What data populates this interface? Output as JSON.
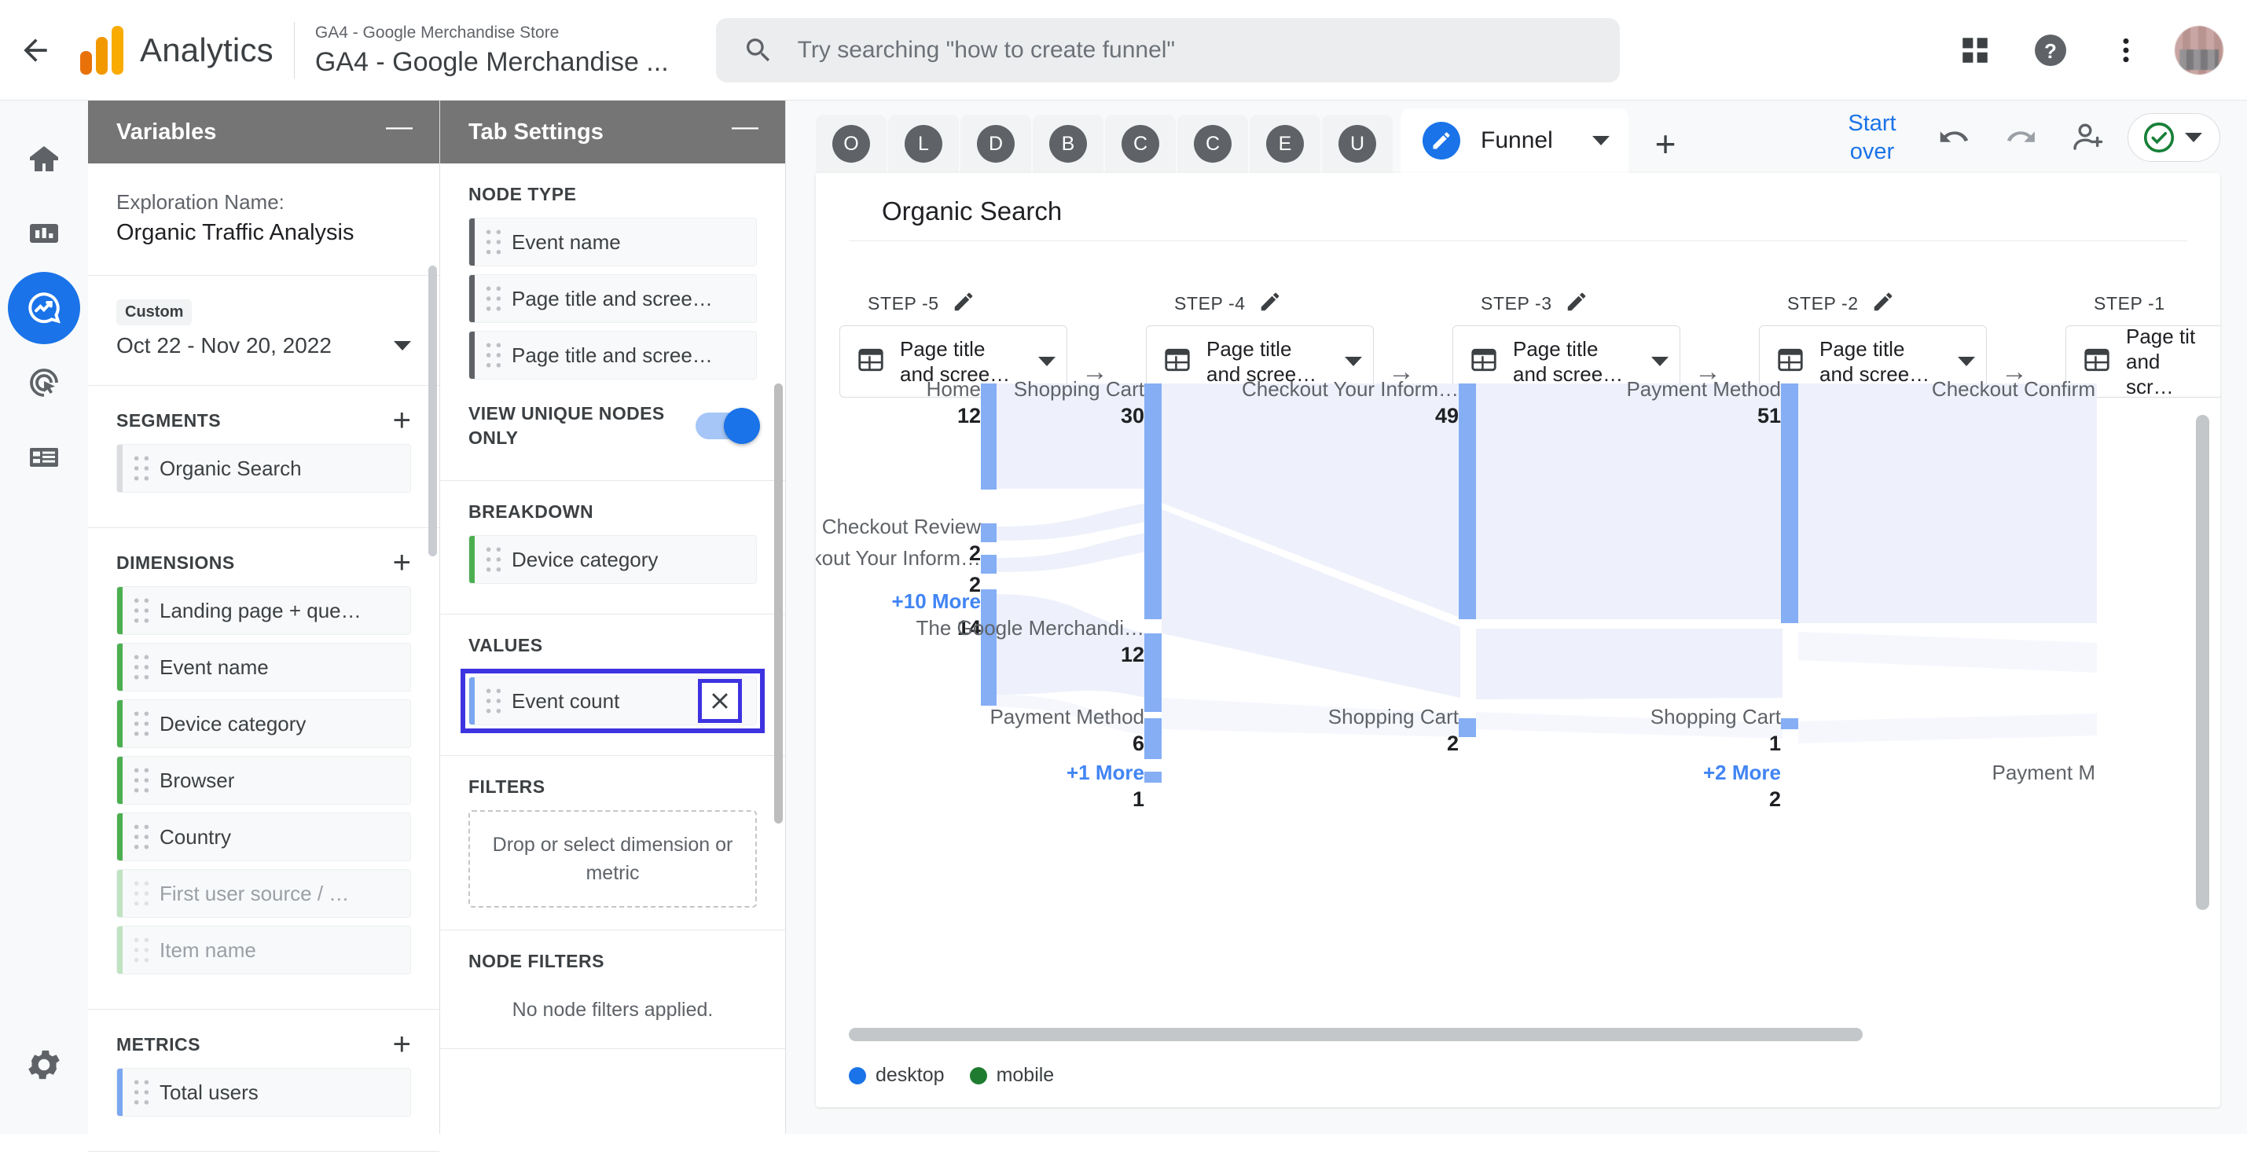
{
  "header": {
    "back_icon": "arrow-left-icon",
    "brand": "Analytics",
    "account_sub": "GA4 - Google Merchandise Store",
    "property_name": "GA4 - Google Merchandise ...",
    "search_placeholder": "Try searching \"how to create funnel\"",
    "search_value": "",
    "apps_icon": "apps-grid-icon",
    "help_icon": "help-circle-icon",
    "more_icon": "more-vertical-icon",
    "avatar_icon": "user-avatar"
  },
  "rail": {
    "items": [
      {
        "name": "home",
        "icon": "home-icon",
        "active": false
      },
      {
        "name": "reports",
        "icon": "bar-chart-icon",
        "active": false
      },
      {
        "name": "explore",
        "icon": "explore-icon",
        "active": true
      },
      {
        "name": "advertising",
        "icon": "advertising-target-icon",
        "active": false
      },
      {
        "name": "library",
        "icon": "library-list-icon",
        "active": false
      }
    ],
    "gear": {
      "name": "admin",
      "icon": "gear-icon"
    }
  },
  "variables": {
    "title": "Variables",
    "minimize": "—",
    "exploration_label": "Exploration Name:",
    "exploration_name": "Organic Traffic Analysis",
    "date_chip": "Custom",
    "date_range": "Oct 22 - Nov 20, 2022",
    "segments": {
      "label": "SEGMENTS",
      "add": "+",
      "items": [
        {
          "label": "Organic Search",
          "tone": "grey"
        }
      ]
    },
    "dimensions": {
      "label": "DIMENSIONS",
      "add": "+",
      "items": [
        {
          "label": "Landing page + que…",
          "tone": "green"
        },
        {
          "label": "Event name",
          "tone": "green"
        },
        {
          "label": "Device category",
          "tone": "green"
        },
        {
          "label": "Browser",
          "tone": "green"
        },
        {
          "label": "Country",
          "tone": "green"
        },
        {
          "label": "First user source / …",
          "tone": "greenlight"
        },
        {
          "label": "Item name",
          "tone": "greenlight"
        }
      ]
    },
    "metrics": {
      "label": "METRICS",
      "add": "+",
      "items": [
        {
          "label": "Total users",
          "tone": "blue"
        }
      ]
    }
  },
  "tab_settings": {
    "title": "Tab Settings",
    "minimize": "—",
    "node_type": {
      "label": "NODE TYPE",
      "items": [
        {
          "label": "Event name"
        },
        {
          "label": "Page title and scree…"
        },
        {
          "label": "Page title and scree…"
        }
      ]
    },
    "view_unique_nodes": {
      "label": "VIEW UNIQUE NODES ONLY",
      "on": true
    },
    "breakdown": {
      "label": "BREAKDOWN",
      "items": [
        {
          "label": "Device category",
          "tone": "green"
        }
      ]
    },
    "values": {
      "label": "VALUES",
      "items": [
        {
          "label": "Event count",
          "tone": "blue",
          "remove_icon": "close-icon"
        }
      ],
      "highlighted": true
    },
    "filters": {
      "label": "FILTERS",
      "dropzone": "Drop or select dimension or metric"
    },
    "node_filters": {
      "label": "NODE FILTERS",
      "empty": "No node filters applied."
    }
  },
  "toolbar": {
    "mini_tabs": [
      "O",
      "L",
      "D",
      "B",
      "C",
      "C",
      "E",
      "U"
    ],
    "active_tab": {
      "label": "Funnel",
      "icon": "pencil-circle-icon",
      "caret": "chevron-down-icon"
    },
    "add_tab": "+",
    "start_over": "Start over",
    "undo_icon": "undo-icon",
    "redo_icon": "redo-icon",
    "share_icon": "add-person-icon",
    "save_status_icon": "check-circle-icon",
    "save_caret": "chevron-down-icon"
  },
  "canvas": {
    "title": "Organic Search"
  },
  "chart_data": {
    "type": "sankey",
    "title": "Organic Search",
    "value_metric": "Event count",
    "breakdown_dimension": "Device category",
    "legend": [
      {
        "label": "desktop",
        "color": "#1a73e8"
      },
      {
        "label": "mobile",
        "color": "#1e7b30"
      }
    ],
    "legend_position": "bottom-left",
    "step_edit_icon": "pencil-icon",
    "step_arrow_icon": "arrow-right-icon",
    "step_node_icon": "page-title-icon",
    "steps": [
      {
        "step_label": "STEP -5",
        "selector": "Page title and scree…",
        "nodes": [
          {
            "label": "Home",
            "value": 12,
            "more": false
          },
          {
            "label": "Checkout Review",
            "value": 2,
            "more": false
          },
          {
            "label": "Checkout Your Inform…",
            "value": 2,
            "more": false
          },
          {
            "label": "+10 More",
            "value": 14,
            "more": true
          }
        ]
      },
      {
        "step_label": "STEP -4",
        "selector": "Page title and scree…",
        "nodes": [
          {
            "label": "Shopping Cart",
            "value": 30,
            "more": false
          },
          {
            "label": "The Google Merchandi…",
            "value": 12,
            "more": false
          },
          {
            "label": "Payment Method",
            "value": 6,
            "more": false
          },
          {
            "label": "+1 More",
            "value": 1,
            "more": true
          }
        ]
      },
      {
        "step_label": "STEP -3",
        "selector": "Page title and scree…",
        "nodes": [
          {
            "label": "Checkout Your Inform…",
            "value": 49,
            "more": false
          },
          {
            "label": "Shopping Cart",
            "value": 2,
            "more": false
          }
        ]
      },
      {
        "step_label": "STEP -2",
        "selector": "Page title and scree…",
        "nodes": [
          {
            "label": "Payment Method",
            "value": 51,
            "more": false
          },
          {
            "label": "Shopping Cart",
            "value": 1,
            "more": false
          },
          {
            "label": "+2 More",
            "value": 2,
            "more": true
          }
        ]
      },
      {
        "step_label": "STEP -1",
        "selector": "Page tit and scr…",
        "nodes": [
          {
            "label": "Checkout Confirm",
            "value": null,
            "more": false
          },
          {
            "label": "Payment M",
            "value": null,
            "more": false
          }
        ]
      }
    ]
  }
}
